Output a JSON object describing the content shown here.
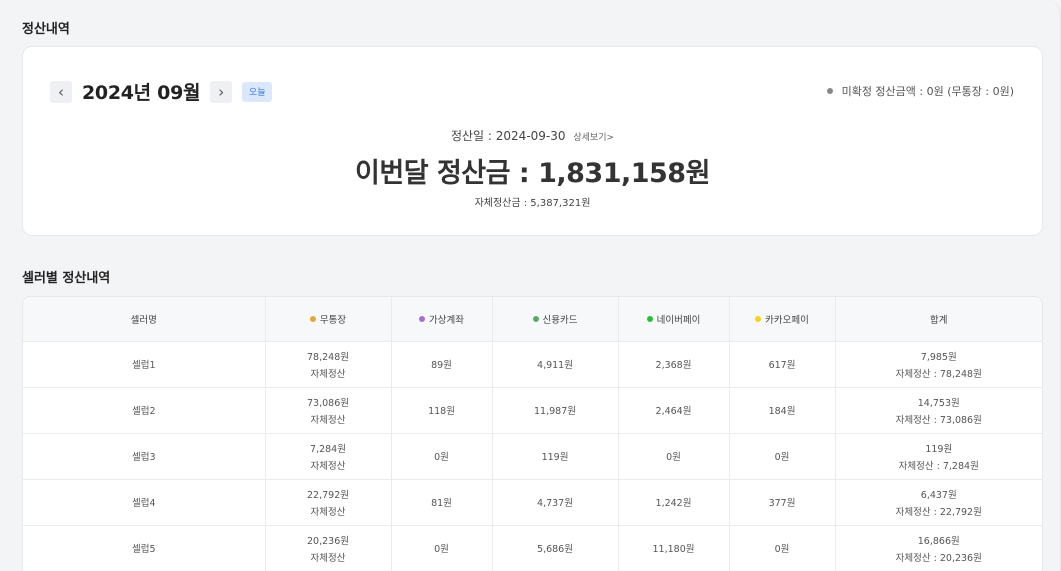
{
  "page": {
    "title": "정산내역",
    "seller_section_title": "셀러별 정산내역"
  },
  "summary": {
    "month": "2024년 09월",
    "prev_icon": "chevron-left-icon",
    "next_icon": "chevron-right-icon",
    "today_label": "오늘",
    "pending_text": "미확정 정산금액 : 0원 (무통장 : 0원)",
    "settle_date_label": "정산일 :",
    "settle_date": "2024-09-30",
    "detail_link": "상세보기>",
    "amount_label": "이번달 정산금 :",
    "amount_value": "1,831,158원",
    "self_settle": "자체정산금 : 5,387,321원"
  },
  "colors": {
    "bank": "#e5a53a",
    "virtual": "#a66fd6",
    "card": "#5caa68",
    "naver": "#22c232",
    "kakao": "#f7d31a",
    "pending_dot": "#888888",
    "accent": "#3b7be0"
  },
  "table": {
    "headers": {
      "seller": "셀러명",
      "bank": "무통장",
      "virtual": "가상계좌",
      "card": "신용카드",
      "naver": "네이버페이",
      "kakao": "카카오페이",
      "total": "합계"
    },
    "rows": [
      {
        "seller": "셀럽1",
        "bank": "78,248원",
        "bank_sub": "자체정산",
        "virtual": "89원",
        "card": "4,911원",
        "naver": "2,368원",
        "kakao": "617원",
        "total": "7,985원",
        "total_sub": "자체정산 : 78,248원"
      },
      {
        "seller": "셀럽2",
        "bank": "73,086원",
        "bank_sub": "자체정산",
        "virtual": "118원",
        "card": "11,987원",
        "naver": "2,464원",
        "kakao": "184원",
        "total": "14,753원",
        "total_sub": "자체정산 : 73,086원"
      },
      {
        "seller": "셀럽3",
        "bank": "7,284원",
        "bank_sub": "자체정산",
        "virtual": "0원",
        "card": "119원",
        "naver": "0원",
        "kakao": "0원",
        "total": "119원",
        "total_sub": "자체정산 : 7,284원"
      },
      {
        "seller": "셀럽4",
        "bank": "22,792원",
        "bank_sub": "자체정산",
        "virtual": "81원",
        "card": "4,737원",
        "naver": "1,242원",
        "kakao": "377원",
        "total": "6,437원",
        "total_sub": "자체정산 : 22,792원"
      },
      {
        "seller": "셀럽5",
        "bank": "20,236원",
        "bank_sub": "자체정산",
        "virtual": "0원",
        "card": "5,686원",
        "naver": "11,180원",
        "kakao": "0원",
        "total": "16,866원",
        "total_sub": "자체정산 : 20,236원"
      }
    ]
  }
}
